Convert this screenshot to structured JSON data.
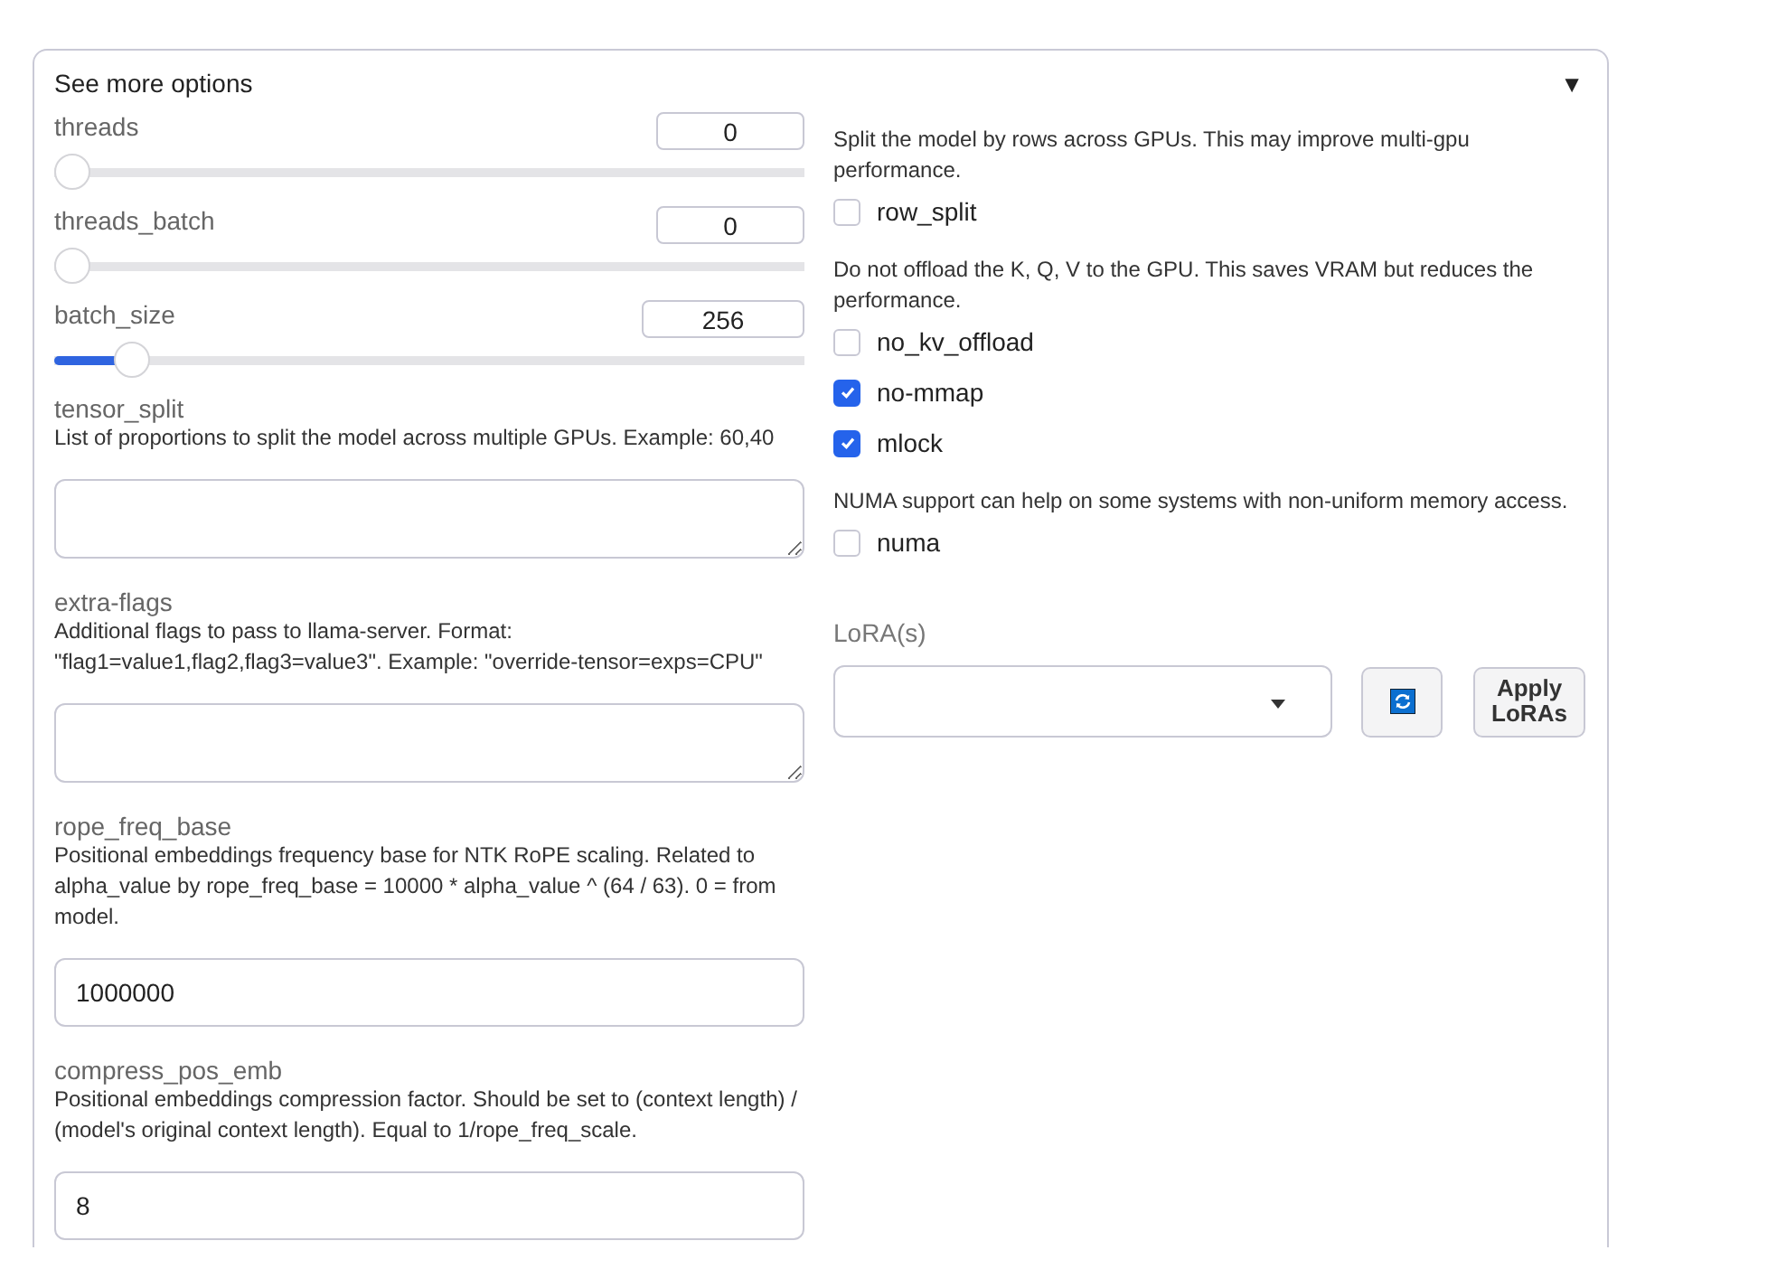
{
  "panel": {
    "title": "See more options",
    "expanded": true,
    "caret": "▼"
  },
  "left": [
    {
      "kind": "slider",
      "label": "threads",
      "value": "0",
      "level": 0
    },
    {
      "kind": "slider",
      "label": "threads_batch",
      "value": "0",
      "level": 0
    },
    {
      "kind": "slider",
      "label": "batch_size",
      "value": "256",
      "level": 0.08
    },
    {
      "kind": "textarea",
      "label": "tensor_split",
      "description": "List of proportions to split the model across multiple GPUs. Example: 60,40"
    },
    {
      "kind": "textarea",
      "label": "extra-flags",
      "description": "Additional flags to pass to llama-server. Format: \"flag1=value1,flag2,flag3=value3\". Example: \"override-tensor=exps=CPU\""
    },
    {
      "kind": "input",
      "label": "rope_freq_base",
      "description": "Positional embeddings frequency base for NTK RoPE scaling. Related to alpha_value by rope_freq_base = 10000 * alpha_value ^ (64 / 63). 0 = from model.",
      "value": "1000000"
    },
    {
      "kind": "input",
      "label": "compress_pos_emb",
      "description": "Positional embeddings compression factor. Should be set to (context length) / (model's original context length). Equal to 1/rope_freq_scale.",
      "value": "8"
    }
  ],
  "right": [
    {
      "description": "Split the model by rows across GPUs. This may improve multi-gpu performance.",
      "checkboxes": [
        {
          "label": "row_split",
          "checked": false
        }
      ]
    },
    {
      "description": "Do not offload the K, Q, V to the GPU. This saves VRAM but reduces the performance.",
      "checkboxes": [
        {
          "label": "no_kv_offload",
          "checked": false
        },
        {
          "label": "no-mmap",
          "checked": true
        },
        {
          "label": "mlock",
          "checked": true
        }
      ]
    },
    {
      "description": "NUMA support can help on some systems with non-uniform memory access.",
      "checkboxes": [
        {
          "label": "numa",
          "checked": false
        }
      ]
    }
  ],
  "lora": {
    "label": "LoRA(s)",
    "apply_button": "Apply LoRAs"
  }
}
